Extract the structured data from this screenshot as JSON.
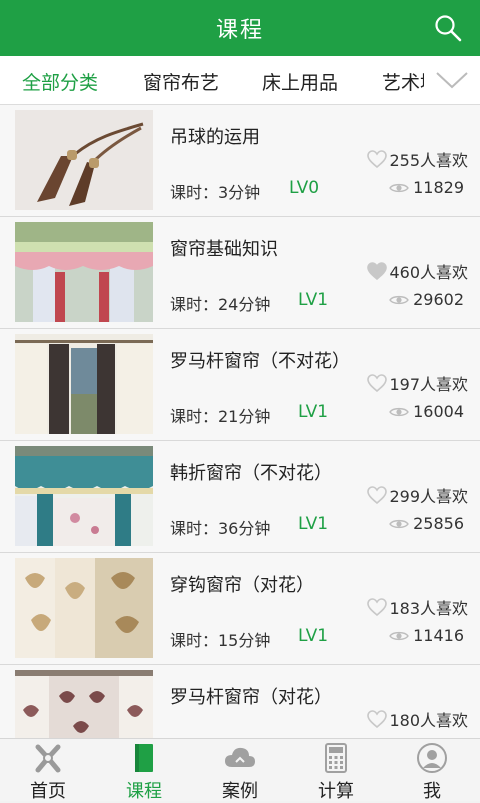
{
  "header": {
    "title": "课程"
  },
  "categories": [
    "全部分类",
    "窗帘布艺",
    "床上用品",
    "艺术墙"
  ],
  "courses": [
    {
      "title": "吊球的运用",
      "duration": "课时：3分钟",
      "level": "LV0",
      "likes": "255人喜欢",
      "views": "11829",
      "liked": false
    },
    {
      "title": "窗帘基础知识",
      "duration": "课时：24分钟",
      "level": "LV1",
      "likes": "460人喜欢",
      "views": "29602",
      "liked": true
    },
    {
      "title": "罗马杆窗帘（不对花）",
      "duration": "课时：21分钟",
      "level": "LV1",
      "likes": "197人喜欢",
      "views": "16004",
      "liked": false
    },
    {
      "title": "韩折窗帘（不对花）",
      "duration": "课时：36分钟",
      "level": "LV1",
      "likes": "299人喜欢",
      "views": "25856",
      "liked": false
    },
    {
      "title": "穿钩窗帘（对花）",
      "duration": "课时：15分钟",
      "level": "LV1",
      "likes": "183人喜欢",
      "views": "11416",
      "liked": false
    },
    {
      "title": "罗马杆窗帘（对花）",
      "duration": "",
      "level": "",
      "likes": "180人喜欢",
      "views": "",
      "liked": false
    }
  ],
  "nav": [
    {
      "label": "首页",
      "icon": "home-icon",
      "active": false
    },
    {
      "label": "课程",
      "icon": "course-book-icon",
      "active": true
    },
    {
      "label": "案例",
      "icon": "cloud-icon",
      "active": false
    },
    {
      "label": "计算",
      "icon": "calculator-icon",
      "active": false
    },
    {
      "label": "我",
      "icon": "user-icon",
      "active": false
    }
  ],
  "colors": {
    "brand_green": "#1fa045"
  }
}
